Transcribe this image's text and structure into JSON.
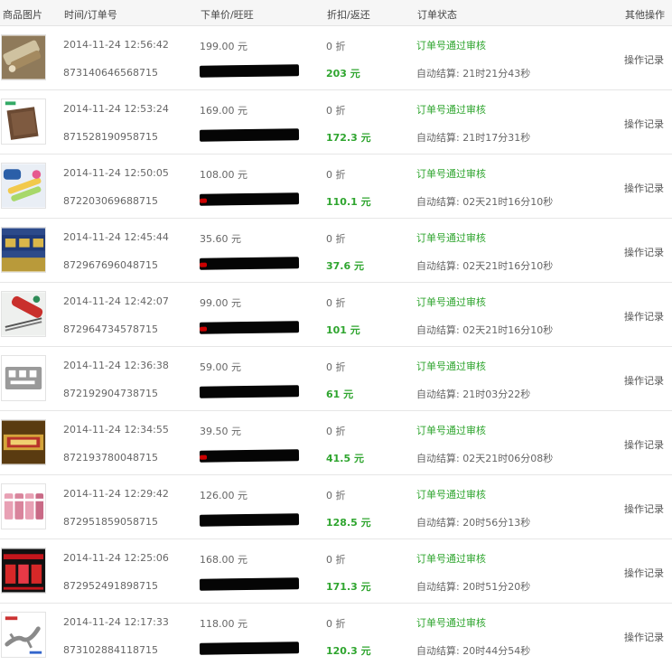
{
  "header": {
    "image": "商品图片",
    "time_order": "时间/订单号",
    "price_wang": "下单价/旺旺",
    "discount_rebate": "折扣/返还",
    "status": "订单状态",
    "other": "其他操作"
  },
  "rows": [
    {
      "time": "2014-11-24 12:56:42",
      "order_no": "873140646568715",
      "price": "199.00 元",
      "discount": "0 折",
      "rebate": "203 元",
      "status": "订单号通过审核",
      "settle": "自动结算: 21时21分43秒",
      "op": "操作记录",
      "thumb_icon": "hair-comb-product-icon"
    },
    {
      "time": "2014-11-24 12:53:24",
      "order_no": "871528190958715",
      "price": "169.00 元",
      "discount": "0 折",
      "rebate": "172.3 元",
      "status": "订单号通过审核",
      "settle": "自动结算: 21时17分31秒",
      "op": "操作记录",
      "thumb_icon": "towel-product-icon"
    },
    {
      "time": "2014-11-24 12:50:05",
      "order_no": "872203069688715",
      "price": "108.00 元",
      "discount": "0 折",
      "rebate": "110.1 元",
      "status": "订单号通过审核",
      "settle": "自动结算: 02天21时16分10秒",
      "op": "操作记录",
      "thumb_icon": "toothbrush-product-icon"
    },
    {
      "time": "2014-11-24 12:45:44",
      "order_no": "872967696048715",
      "price": "35.60 元",
      "discount": "0 折",
      "rebate": "37.6 元",
      "status": "订单号通过审核",
      "settle": "自动结算: 02天21时16分10秒",
      "op": "操作记录",
      "thumb_icon": "tea-box-product-icon"
    },
    {
      "time": "2014-11-24 12:42:07",
      "order_no": "872964734578715",
      "price": "99.00 元",
      "discount": "0 折",
      "rebate": "101 元",
      "status": "订单号通过审核",
      "settle": "自动结算: 02天21时16分10秒",
      "op": "操作记录",
      "thumb_icon": "chopsticks-product-icon"
    },
    {
      "time": "2014-11-24 12:36:38",
      "order_no": "872192904738715",
      "price": "59.00 元",
      "discount": "0 折",
      "rebate": "61 元",
      "status": "订单号通过审核",
      "settle": "自动结算: 21时03分22秒",
      "op": "操作记录",
      "thumb_icon": "multitool-card-product-icon"
    },
    {
      "time": "2014-11-24 12:34:55",
      "order_no": "872193780048715",
      "price": "39.50 元",
      "discount": "0 折",
      "rebate": "41.5 元",
      "status": "订单号通过审核",
      "settle": "自动结算: 02天21时06分08秒",
      "op": "操作记录",
      "thumb_icon": "gold-plaque-product-icon"
    },
    {
      "time": "2014-11-24 12:29:42",
      "order_no": "872951859058715",
      "price": "126.00 元",
      "discount": "0 折",
      "rebate": "128.5 元",
      "status": "订单号通过审核",
      "settle": "自动结算: 20时56分13秒",
      "op": "操作记录",
      "thumb_icon": "cosmetics-product-icon"
    },
    {
      "time": "2014-11-24 12:25:06",
      "order_no": "872952491898715",
      "price": "168.00 元",
      "discount": "0 折",
      "rebate": "171.3 元",
      "status": "订单号通过审核",
      "settle": "自动结算: 20时51分20秒",
      "op": "操作记录",
      "thumb_icon": "red-package-product-icon"
    },
    {
      "time": "2014-11-24 12:17:33",
      "order_no": "873102884118715",
      "price": "118.00 元",
      "discount": "0 折",
      "rebate": "120.3 元",
      "status": "订单号通过审核",
      "settle": "自动结算: 20时44分54秒",
      "op": "操作记录",
      "thumb_icon": "lizard-ornament-product-icon"
    }
  ],
  "colors": {
    "accent_green": "#2fa52f",
    "header_bg": "#f6f6f6",
    "redaction": "#050505"
  }
}
